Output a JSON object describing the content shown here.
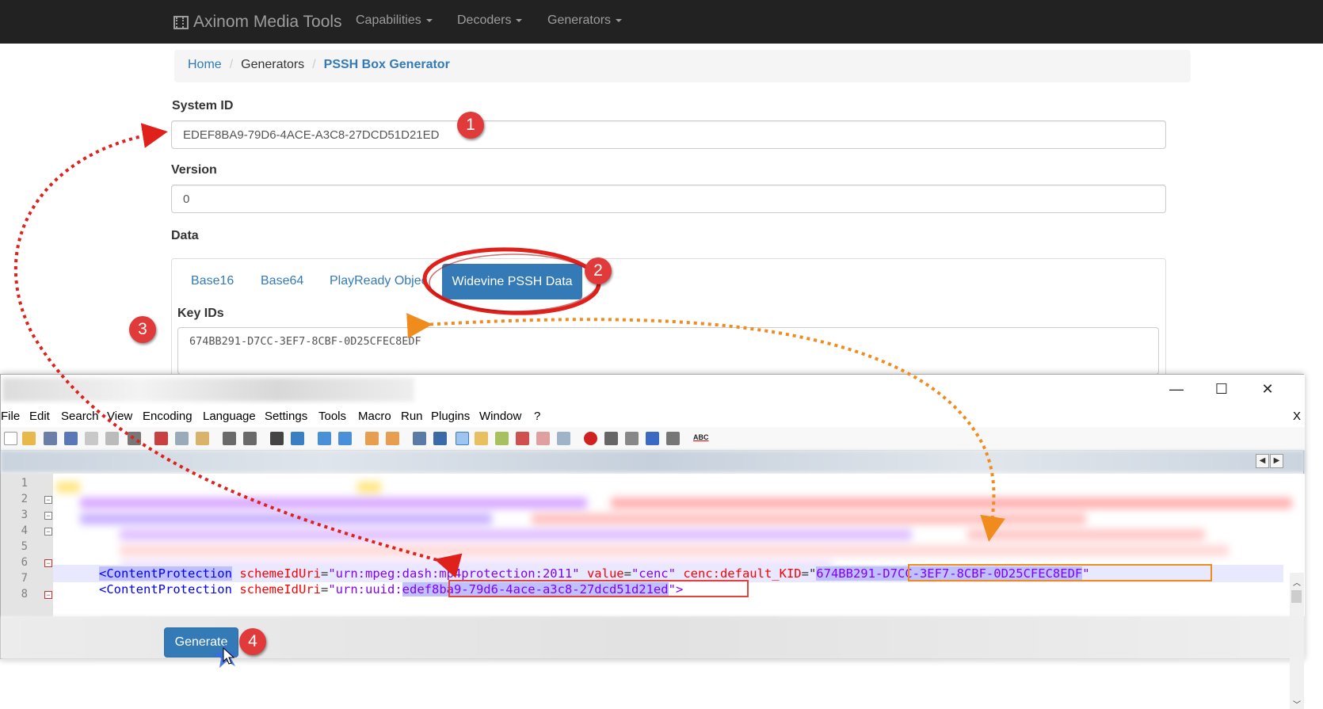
{
  "navbar": {
    "brand": "Axinom Media Tools",
    "items": [
      "Capabilities",
      "Decoders",
      "Generators"
    ]
  },
  "breadcrumb": {
    "home": "Home",
    "generators": "Generators",
    "current": "PSSH Box Generator"
  },
  "form": {
    "system_id_label": "System ID",
    "system_id_value": "EDEF8BA9-79D6-4ACE-A3C8-27DCD51D21ED",
    "version_label": "Version",
    "version_value": "0",
    "data_label": "Data",
    "tabs": [
      "Base16",
      "Base64",
      "PlayReady Objec",
      "Widevine PSSH Data"
    ],
    "key_ids_label": "Key IDs",
    "key_ids_value": "674BB291-D7CC-3EF7-8CBF-0D25CFEC8EDF",
    "generate_label": "Generate"
  },
  "markers": [
    "1",
    "2",
    "3",
    "4"
  ],
  "editor": {
    "window_controls": [
      "—",
      "☐",
      "✕"
    ],
    "menu": [
      "File",
      "Edit",
      "Search",
      "View",
      "Encoding",
      "Language",
      "Settings",
      "Tools",
      "Macro",
      "Run",
      "Plugins",
      "Window",
      "?"
    ],
    "menu_close": "X",
    "line_numbers": [
      "1",
      "2",
      "3",
      "4",
      "5",
      "6",
      "7",
      "8"
    ],
    "line7": {
      "tag": "<ContentProtection",
      "attr1": "schemeIdUri",
      "eq1": "=",
      "val1": "\"urn:mpeg:dash:mp4protection:2011\"",
      "attr2": "value",
      "eq2": "=",
      "val2": "\"cenc\"",
      "attr3": "cenc:default_KID",
      "eq3": "=\"",
      "kid": "674BB291-D7CC-3EF7-8CBF-0D25CFEC8EDF",
      "end": "\""
    },
    "line8": {
      "tag": "<ContentProtection",
      "attr1": "schemeIdUri",
      "eq1": "=",
      "val1_prefix": "\"urn:uuid:",
      "uuid": "edef8ba9-79d6-4ace-a3c8-27dcd51d21ed",
      "end": "\">"
    },
    "toolbar_last_label": "ABC"
  },
  "colors": {
    "navbar": "#222222",
    "primary": "#337ab7",
    "marker": "#e03a3a",
    "arrow_red": "#e0201a",
    "arrow_orange": "#f08c1e"
  }
}
